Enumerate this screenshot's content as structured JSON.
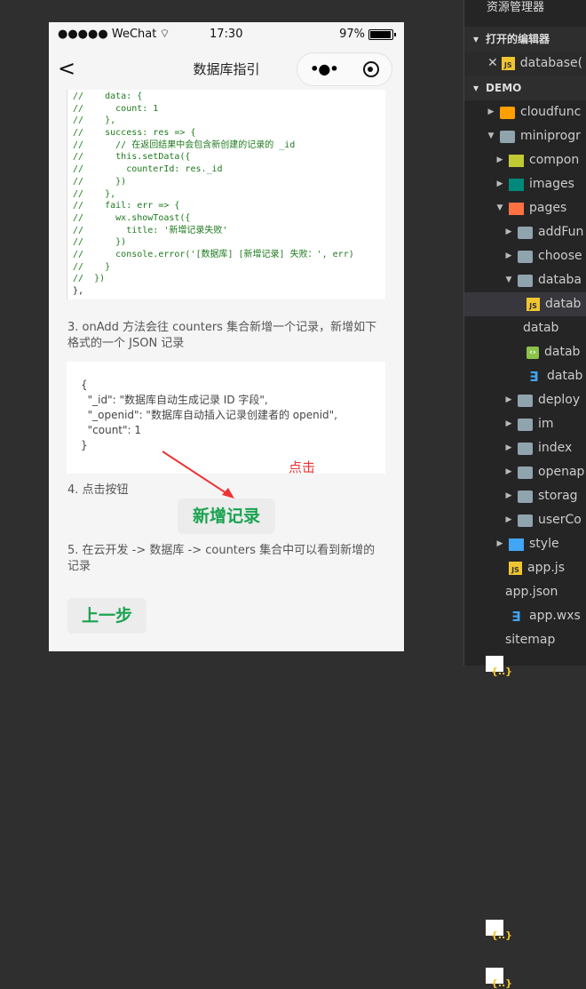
{
  "status_bar": {
    "carrier": "●●●●● WeChat",
    "time": "17:30",
    "battery": "97%"
  },
  "nav": {
    "title": "数据库指引"
  },
  "code_lines": [
    "//    data: {",
    "//      count: 1",
    "//    },",
    "//    success: res => {",
    "//      // 在返回结果中会包含新创建的记录的 _id",
    "//      this.setData({",
    "//        counterId: res._id",
    "//      })",
    "//    },",
    "//    fail: err => {",
    "//      wx.showToast({",
    "//        title: '新增记录失败'",
    "//      })",
    "//      console.error('[数据库] [新增记录] 失败：', err)",
    "//    }",
    "//  })",
    "},"
  ],
  "step3": "3. onAdd 方法会往 counters 集合新增一个记录，新增如下格式的一个 JSON 记录",
  "json_lines": [
    "{",
    "  \"_id\": \"数据库自动生成记录 ID 字段\",",
    "  \"_openid\": \"数据库自动插入记录创建者的 openid\",",
    "  \"count\": 1",
    "}"
  ],
  "annotation": "点击",
  "step4": "4. 点击按钮",
  "add_button": "新增记录",
  "step5": "5. 在云开发 -> 数据库 -> counters 集合中可以看到新增的记录",
  "prev_button": "上一步",
  "explorer": {
    "title": "资源管理器",
    "open_editors": "打开的编辑器",
    "open_file": "database(",
    "project": "DEMO",
    "tree": [
      {
        "label": "cloudfunc",
        "icon": "cloud",
        "depth": 1,
        "twisty": "▶"
      },
      {
        "label": "miniprogr",
        "icon": "folder",
        "depth": 1,
        "twisty": "▼"
      },
      {
        "label": "compon",
        "icon": "comp",
        "depth": 2,
        "twisty": "▶"
      },
      {
        "label": "images",
        "icon": "img",
        "depth": 2,
        "twisty": "▶"
      },
      {
        "label": "pages",
        "icon": "pages",
        "depth": 2,
        "twisty": "▼"
      },
      {
        "label": "addFun",
        "icon": "folder",
        "depth": 3,
        "twisty": "▶"
      },
      {
        "label": "choose",
        "icon": "folder",
        "depth": 3,
        "twisty": "▶"
      },
      {
        "label": "databa",
        "icon": "folder",
        "depth": 3,
        "twisty": "▼"
      },
      {
        "label": "datab",
        "icon": "js",
        "depth": 4,
        "twisty": "",
        "selected": true
      },
      {
        "label": "datab",
        "icon": "json",
        "depth": 4,
        "twisty": ""
      },
      {
        "label": "datab",
        "icon": "wxml",
        "depth": 4,
        "twisty": ""
      },
      {
        "label": "datab",
        "icon": "css",
        "depth": 4,
        "twisty": ""
      },
      {
        "label": "deploy",
        "icon": "folder",
        "depth": 3,
        "twisty": "▶"
      },
      {
        "label": "im",
        "icon": "folder",
        "depth": 3,
        "twisty": "▶"
      },
      {
        "label": "index",
        "icon": "folder",
        "depth": 3,
        "twisty": "▶"
      },
      {
        "label": "openap",
        "icon": "folder",
        "depth": 3,
        "twisty": "▶"
      },
      {
        "label": "storag",
        "icon": "folder",
        "depth": 3,
        "twisty": "▶"
      },
      {
        "label": "userCo",
        "icon": "folder",
        "depth": 3,
        "twisty": "▶"
      },
      {
        "label": "style",
        "icon": "style",
        "depth": 2,
        "twisty": "▶"
      },
      {
        "label": "app.js",
        "icon": "js",
        "depth": 2,
        "twisty": ""
      },
      {
        "label": "app.json",
        "icon": "json",
        "depth": 2,
        "twisty": ""
      },
      {
        "label": "app.wxs",
        "icon": "css",
        "depth": 2,
        "twisty": ""
      },
      {
        "label": "sitemap",
        "icon": "json",
        "depth": 2,
        "twisty": ""
      }
    ]
  }
}
